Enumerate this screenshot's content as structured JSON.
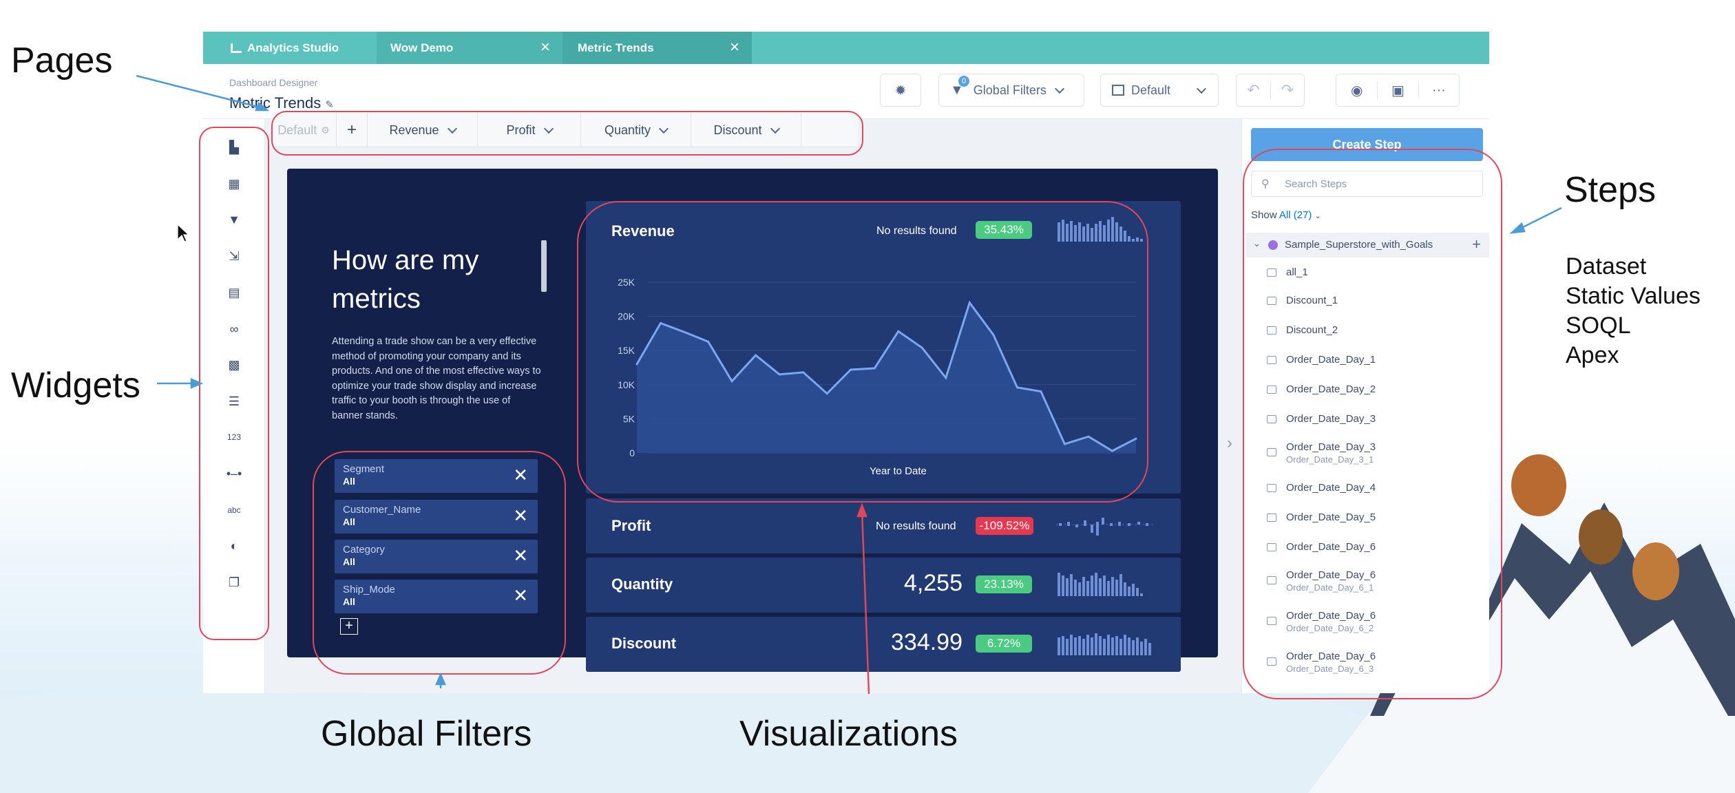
{
  "annotations": {
    "pages": "Pages",
    "widgets": "Widgets",
    "global_filters": "Global Filters",
    "visualizations": "Visualizations",
    "steps": "Steps",
    "steps_sources": [
      "Dataset",
      "Static Values",
      "SOQL",
      "Apex"
    ]
  },
  "tabs": [
    {
      "label": "Analytics Studio",
      "icon": "bar-chart-icon"
    },
    {
      "label": "Wow Demo"
    },
    {
      "label": "Metric Trends",
      "active": true
    }
  ],
  "header": {
    "subtitle": "Dashboard Designer",
    "title": "Metric Trends",
    "global_filters_label": "Global Filters",
    "global_filters_count": "0",
    "layout_label": "Default"
  },
  "pages": {
    "default_label": "Default",
    "tabs": [
      "Revenue",
      "Profit",
      "Quantity",
      "Discount"
    ]
  },
  "widgets": [
    "chart-icon",
    "table-icon",
    "filter-icon",
    "compare-icon",
    "date-icon",
    "link-icon",
    "image-icon",
    "list-icon",
    "number-icon",
    "range-icon",
    "text-icon",
    "toggle-icon",
    "container-icon"
  ],
  "intro": {
    "heading": "How are my metrics",
    "body": "Attending a trade show can be a very effective method of promoting your company and its products. And one of the most effective ways to optimize your trade show display and increase traffic to your booth is through the use of banner stands."
  },
  "filters": [
    {
      "name": "Segment",
      "value": "All"
    },
    {
      "name": "Customer_Name",
      "value": "All"
    },
    {
      "name": "Category",
      "value": "All"
    },
    {
      "name": "Ship_Mode",
      "value": "All"
    }
  ],
  "revenue": {
    "title": "Revenue",
    "no_results": "No results found",
    "badge": "35.43%",
    "xlabel": "Year to Date"
  },
  "metrics": [
    {
      "title": "Profit",
      "value": "No results found",
      "badge": "-109.52%",
      "badge_color": "#e63950"
    },
    {
      "title": "Quantity",
      "value": "4,255",
      "badge": "23.13%",
      "badge_color": "#4bca81"
    },
    {
      "title": "Discount",
      "value": "334.99",
      "badge": "6.72%",
      "badge_color": "#4bca81"
    }
  ],
  "steps_panel": {
    "create_label": "Create Step",
    "search_placeholder": "Search Steps",
    "show_label": "Show",
    "show_value": "All (27)",
    "dataset": "Sample_Superstore_with_Goals",
    "items": [
      {
        "name": "all_1",
        "sub": ""
      },
      {
        "name": "Discount_1",
        "sub": ""
      },
      {
        "name": "Discount_2",
        "sub": ""
      },
      {
        "name": "Order_Date_Day_1",
        "sub": ""
      },
      {
        "name": "Order_Date_Day_2",
        "sub": ""
      },
      {
        "name": "Order_Date_Day_3",
        "sub": ""
      },
      {
        "name": "Order_Date_Day_3",
        "sub": "Order_Date_Day_3_1"
      },
      {
        "name": "Order_Date_Day_4",
        "sub": ""
      },
      {
        "name": "Order_Date_Day_5",
        "sub": ""
      },
      {
        "name": "Order_Date_Day_6",
        "sub": ""
      },
      {
        "name": "Order_Date_Day_6",
        "sub": "Order_Date_Day_6_1"
      },
      {
        "name": "Order_Date_Day_6",
        "sub": "Order_Date_Day_6_2"
      },
      {
        "name": "Order_Date_Day_6",
        "sub": "Order_Date_Day_6_3"
      }
    ]
  },
  "colors": {
    "teal": "#5bc3be",
    "dash_bg": "#12204a",
    "card": "#213a74",
    "annotation_red": "#e0475b",
    "create_blue": "#5aa2e6",
    "accent_green": "#4bca81",
    "accent_red": "#e63950"
  },
  "chart_data": {
    "type": "area",
    "title": "Revenue",
    "xlabel": "Year to Date",
    "ylabel": "",
    "yticks": [
      "0",
      "5K",
      "10K",
      "15K",
      "20K",
      "25K"
    ],
    "ylim": [
      0,
      25000
    ],
    "series": [
      {
        "values": [
          13000,
          19000,
          17700,
          16300,
          10500,
          14300,
          11500,
          11800,
          8700,
          12200,
          12400,
          17800,
          15400,
          11000,
          22000,
          17300,
          9600,
          9000,
          1300,
          2400,
          300,
          2100
        ]
      }
    ]
  }
}
